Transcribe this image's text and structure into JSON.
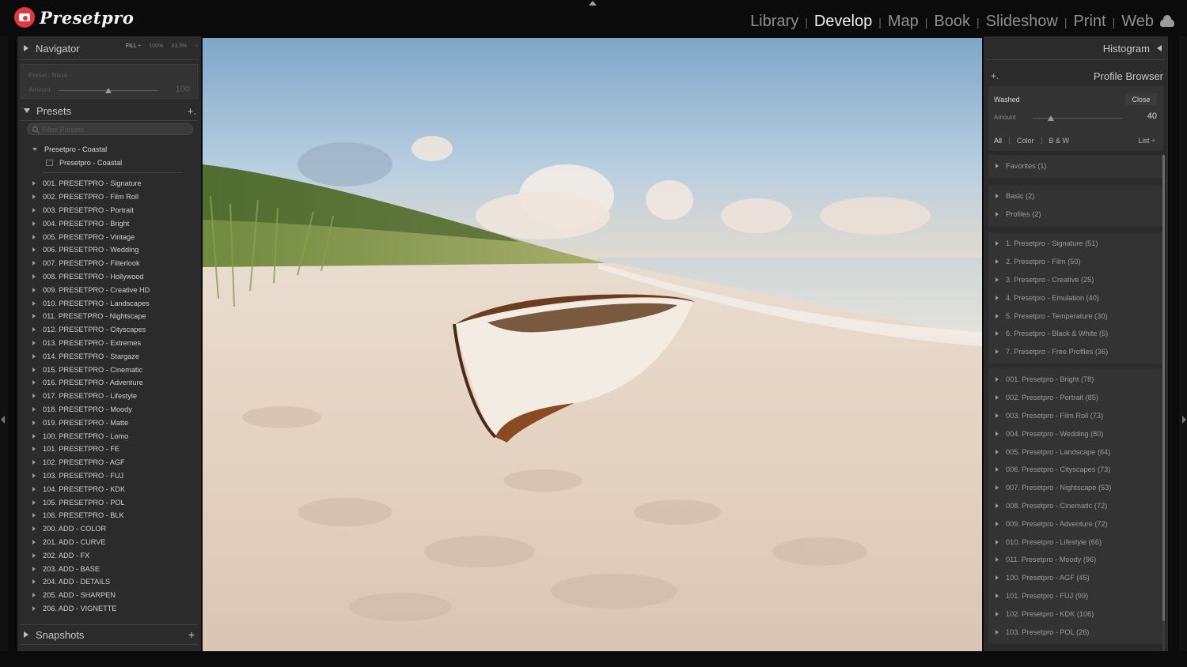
{
  "app": {
    "logo_text": "Presetpro",
    "modules": [
      "Library",
      "Develop",
      "Map",
      "Book",
      "Slideshow",
      "Print",
      "Web"
    ],
    "active_module": "Develop",
    "module_separator": "|"
  },
  "navigator": {
    "title": "Navigator",
    "zoom_options": [
      "FILL ÷",
      "100%",
      "33.3%",
      "÷"
    ],
    "preset_label": "Preset : None",
    "amount_label": "Amount",
    "amount_value": "100",
    "amount_fraction": 0.5
  },
  "presets": {
    "title": "Presets",
    "add_label": "+.",
    "filter_placeholder": "Filter Presets",
    "open_group": "Presetpro - Coastal",
    "open_group_child": "Presetpro - Coastal",
    "items": [
      "001. PRESETPRO - Signature",
      "002. PRESETPRO - Film Roll",
      "003. PRESETPRO - Portrait",
      "004. PRESETPRO - Bright",
      "005. PRESETPRO - Vintage",
      "006. PRESETPRO - Wedding",
      "007. PRESETPRO - Filterlook",
      "008. PRESETPRO - Hollywood",
      "009. PRESETPRO - Creative HD",
      "010. PRESETPRO - Landscapes",
      "011. PRESETPRO - Nightscape",
      "012. PRESETPRO - Cityscapes",
      "013. PRESETPRO - Extremes",
      "014. PRESETPRO - Stargaze",
      "015. PRESETPRO - Cinematic",
      "016. PRESETPRO - Adventure",
      "017. PRESETPRO - Lifestyle",
      "018. PRESETPRO - Moody",
      "019. PRESETPRO - Matte",
      "100. PRESETPRO - Lomo",
      "101. PRESETPRO - FE",
      "102. PRESETPRO - AGF",
      "103. PRESETPRO - FUJ",
      "104. PRESETPRO - KDK",
      "105. PRESETPRO - POL",
      "106. PRESETPRO - BLK",
      "200. ADD - COLOR",
      "201. ADD - CURVE",
      "202. ADD - FX",
      "203. ADD - BASE",
      "204. ADD - DETAILS",
      "205. ADD - SHARPEN",
      "206. ADD - VIGNETTE"
    ]
  },
  "snapshots": {
    "title": "Snapshots",
    "add_label": "+"
  },
  "histogram": {
    "title": "Histogram"
  },
  "profile_browser": {
    "add_label": "+.",
    "title": "Profile Browser",
    "current_profile": "Washed",
    "close_label": "Close",
    "amount_label": "Amount",
    "amount_value": "40",
    "amount_fraction": 0.2,
    "filters": [
      "All",
      "Color",
      "B & W"
    ],
    "view_label": "List ÷",
    "groups": [
      [
        "Favorites (1)"
      ],
      [
        "Basic (2)",
        "Profiles (2)"
      ],
      [
        "1. Presetpro - Signature (51)",
        "2. Presetpro - Film (50)",
        "3. Presetpro - Creative (25)",
        "4. Presetpro - Emulation (40)",
        "5. Presetpro - Temperature (30)",
        "6. Presetpro - Black & White (5)",
        "7. Presetpro - Free Profiles (36)"
      ],
      [
        "001. Presetpro - Bright (78)",
        "002. Presetpro - Portrait (85)",
        "003. Presetpro - Film Roll (73)",
        "004. Presetpro - Wedding (80)",
        "005. Presetpro - Landscape (64)",
        "006. Presetpro - Cityscapes (73)",
        "007. Presetpro - Nightscape (53)",
        "008. Presetpro - Cinematic (72)",
        "009. Presetpro - Adventure (72)",
        "010. Presetpro - Lifestyle (66)",
        "011. Presetpro - Moody (96)",
        "100. Presetpro - AGF (45)",
        "101. Presetpro - FUJ (99)",
        "102. Presetpro - KDK (106)",
        "103. Presetpro - POL (26)"
      ]
    ]
  },
  "colors": {
    "accent_red": "#e0393e",
    "panel_bg": "#2b2b2b",
    "app_bg": "#0b0b0b"
  }
}
